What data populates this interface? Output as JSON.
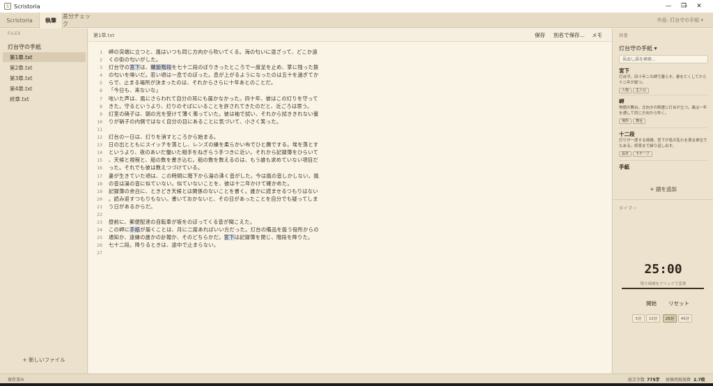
{
  "window": {
    "title": "Scristoria",
    "minimize": "—",
    "maximize": "❐",
    "close": "✕"
  },
  "tabs": [
    {
      "label": "Scristoria"
    },
    {
      "label": "執筆"
    },
    {
      "label": "差分チェック"
    }
  ],
  "work_name": "作品: 灯台守の手紙 ▾",
  "sidebar": {
    "section_label": "FILES",
    "project": "灯台守の手紙",
    "files": [
      "第1章.txt",
      "第2章.txt",
      "第3章.txt",
      "第4章.txt",
      "終章.txt"
    ],
    "new_file": "+ 新しいファイル"
  },
  "editor": {
    "filename": "第1章.txt",
    "buttons": {
      "save": "保存",
      "save_as": "別名で保存...",
      "memo": "メモ"
    },
    "lines": [
      [
        {
          "t": "岬の突端に立つと、風はいつも同じ方向から吹いてくる。海の匂いに混ざって、どこか遠"
        }
      ],
      [
        {
          "t": "くの街の匂いがした。"
        }
      ],
      [
        {
          "t": "灯台守の"
        },
        {
          "t": "宮下",
          "h": true
        },
        {
          "t": "は、"
        },
        {
          "t": "螺旋階段",
          "h": true
        },
        {
          "t": "を七十二段のぼりきったところで一度足を止め、掌に残った鉄"
        }
      ],
      [
        {
          "t": "の匂いを嗅いだ。若い頃は一息でのぼった。息が上がるようになったのは五十を過ぎてか"
        }
      ],
      [
        {
          "t": "らで、止まる場所が決まったのは、それからさらに十年あとのことだ。"
        }
      ],
      [
        {
          "t": "「今日も、来ないな」"
        }
      ],
      [
        {
          "t": "呟いた声は、風にさらわれて自分の耳にも届かなかった。四十年、彼はこの灯りを守って"
        }
      ],
      [
        {
          "t": "きた。守るというより、灯りのそばにいることを許されてきたのだと、近ごろは思う。"
        }
      ],
      [
        {
          "t": "灯室の硝子は、朝の光を受けて薄く濁っていた。彼は袖で拭い、それから拭ききれない曇"
        }
      ],
      [
        {
          "t": "りが硝子の内側ではなく自分の目にあることに気づいて、小さく笑った。"
        }
      ],
      [
        {
          "t": ""
        }
      ],
      [
        {
          "t": "灯台の一日は、灯りを消すところから始まる。"
        }
      ],
      [
        {
          "t": "日の出とともにスイッチを落とし、レンズの縁を柔らかい布でひと撫でする。埃を落とす"
        }
      ],
      [
        {
          "t": "というより、夜のあいだ働いた相手をねぎらう手つきに近い。それから記録簿をひらいて"
        }
      ],
      [
        {
          "t": "、天候と視程と、船の数を書き込む。船の数を数えるのは、もう誰も求めていない項目だ"
        }
      ],
      [
        {
          "t": "った。それでも彼は数えつづけている。"
        }
      ],
      [
        {
          "t": "妻が生きていた頃は、この時間に階下から湯の沸く音がした。今は風の音しかしない。風"
        }
      ],
      [
        {
          "t": "の音は湯の音に似ていない。似ていないことを、彼は十二年かけて確かめた。"
        }
      ],
      [
        {
          "t": "記録簿の余白に、ときどき天候とは関係のないことを書く。誰かに読ませるつもりはない"
        }
      ],
      [
        {
          "t": "。読み返すつもりもない。書いておかないと、その日があったことを自分でも疑ってしま"
        }
      ],
      [
        {
          "t": "う日があるからだ。"
        }
      ],
      [
        {
          "t": ""
        }
      ],
      [
        {
          "t": "昼前に、郵便配達の自転車が坂をのぼってくる音が聞こえた。"
        }
      ],
      [
        {
          "t": "この岬に"
        },
        {
          "t": "手紙",
          "h": true
        },
        {
          "t": "が届くことは、月に二度あればいい方だった。灯台の備品を扱う役所からの"
        }
      ],
      [
        {
          "t": "通知か、遠縁の誰かの訃報か、そのどちらかだ。"
        },
        {
          "t": "宮下",
          "h": true
        },
        {
          "t": "は記録簿を閉じ、階段を降りた。"
        }
      ],
      [
        {
          "t": "七十二段。降りるときは、途中で止まらない。"
        }
      ],
      [
        {
          "t": ""
        }
      ]
    ]
  },
  "glossary": {
    "section_label": "辞書",
    "book": "灯台守の手紙 ▾",
    "search_placeholder": "見出し語を検索...",
    "entries": [
      {
        "term": "宮下",
        "desc": "灯台守。四十年この岬で暮らす。妻を亡くしてから十二年が経つ。",
        "tags": [
          "人物",
          "主人公"
        ]
      },
      {
        "term": "岬",
        "desc": "物語の舞台。北向きの断崖に灯台が立つ。風は一年を通して同じ方向から吹く。",
        "tags": [
          "場所",
          "舞台"
        ]
      },
      {
        "term": "十二段",
        "desc": "灯りが一度する時間。宮下が息の乱れを測る単位でもある。終章まで繰り返し出す。",
        "tags": [
          "設定",
          "モチーフ"
        ]
      },
      {
        "term": "手紙",
        "desc": "",
        "tags": []
      }
    ],
    "add": "+ 語を追加"
  },
  "timer": {
    "section_label": "タイマー",
    "value": "25:00",
    "hint": "残り時間をクリックで変更",
    "progress": 1.0,
    "start": "開始",
    "reset": "リセット",
    "presets": [
      "5分",
      "15分",
      "25分",
      "45分"
    ],
    "selected_preset": "25分"
  },
  "status": {
    "saved": "保存済み",
    "total_chars_label": "総文字数",
    "total_chars": "775字",
    "manuscript_label": "原稿用紙換算",
    "manuscript": "2.7枚"
  }
}
